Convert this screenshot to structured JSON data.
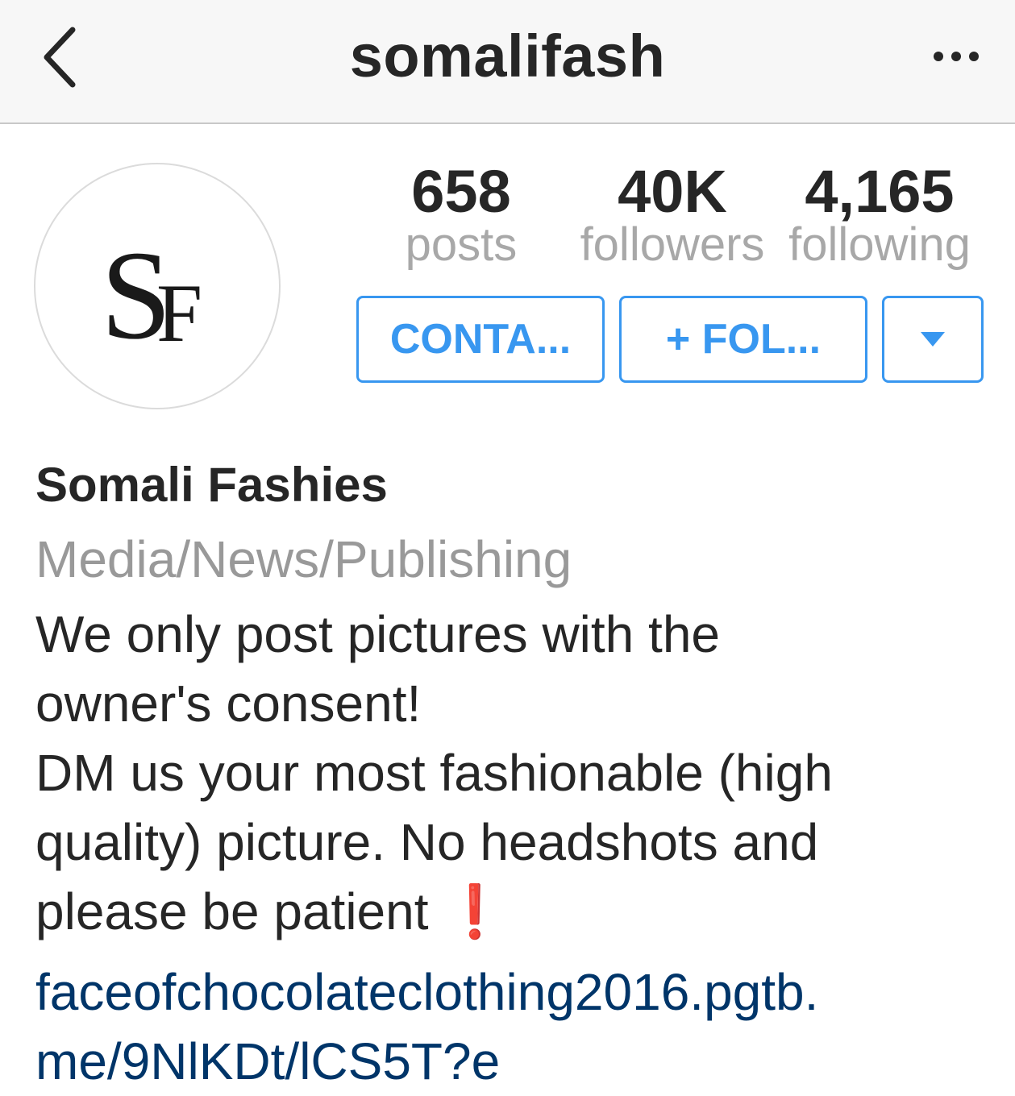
{
  "navbar": {
    "title": "somalifash",
    "back_icon": "chevron-left-icon",
    "more_icon": "more-horizontal-icon"
  },
  "avatar": {
    "logo_text": "SF"
  },
  "stats": {
    "posts": {
      "count": "658",
      "label": "posts"
    },
    "followers": {
      "count": "40K",
      "label": "followers"
    },
    "following": {
      "count": "4,165",
      "label": "following"
    }
  },
  "buttons": {
    "contact_label": "CONTA...",
    "follow_label": "+ FOL...",
    "dropdown_icon": "caret-down-icon"
  },
  "profile": {
    "name": "Somali Fashies",
    "category": "Media/News/Publishing",
    "bio_lines": [
      "We only post pictures with the",
      "owner's consent!",
      "DM us your most fashionable (high",
      "quality) picture. No headshots and",
      "please be patient"
    ],
    "bio_emoji": "❗",
    "link_lines": [
      "faceofchocolateclothing2016.pgtb.",
      "me/9NlKDt/lCS5T?e"
    ]
  },
  "colors": {
    "accent": "#3897f0",
    "link": "#003569",
    "muted": "#999999",
    "text": "#262626",
    "alert": "#e0201f"
  }
}
